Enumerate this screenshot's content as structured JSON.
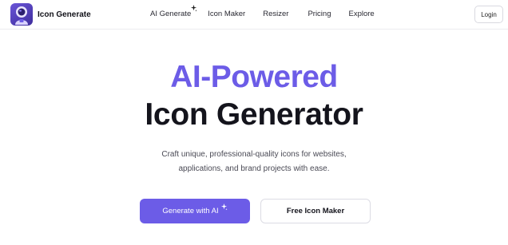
{
  "brand": {
    "name": "Icon Generate",
    "logo_icon": "astronaut-icon",
    "logo_color": "#5a46c9"
  },
  "nav": {
    "items": [
      {
        "label": "AI Generate",
        "icon": "sparkle-icon"
      },
      {
        "label": "Icon Maker"
      },
      {
        "label": "Resizer"
      },
      {
        "label": "Pricing"
      },
      {
        "label": "Explore"
      }
    ],
    "login_label": "Login"
  },
  "hero": {
    "title_line1": "AI-Powered",
    "title_line2": "Icon Generator",
    "subtitle_line1": "Craft unique, professional-quality icons for websites,",
    "subtitle_line2": "applications, and brand projects with ease.",
    "primary_button": "Generate with AI",
    "primary_button_icon": "sparkle-icon",
    "secondary_button": "Free Icon Maker"
  },
  "colors": {
    "accent": "#6c5ce7",
    "heading": "#14141c",
    "body_text": "#4a4a55"
  }
}
